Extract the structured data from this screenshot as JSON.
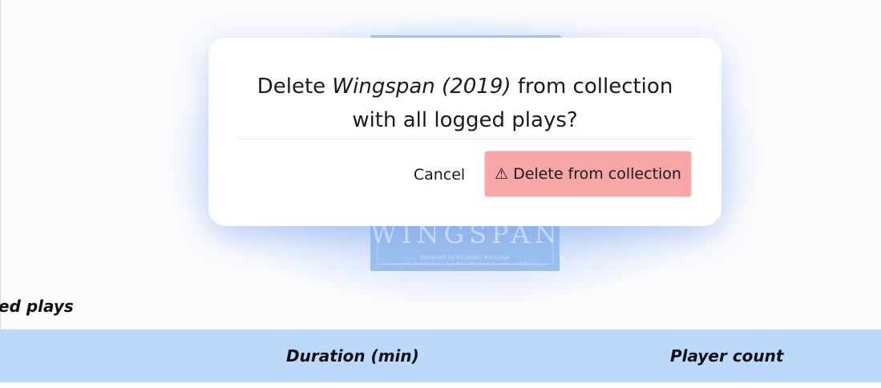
{
  "background": {
    "cover_title": "WINGSPAN",
    "cover_subtitle_1": "Designed by Elizabeth Hargrave",
    "cover_subtitle_2": "Illustrated by Natalia Rojas, Ana Maria Martinez Jaramillo, and Beth Sobel"
  },
  "section": {
    "title": "Logged plays",
    "title_visible": "ed plays"
  },
  "table": {
    "columns": [
      "Duration (min)",
      "Player count"
    ]
  },
  "dialog": {
    "message_prefix": "Delete ",
    "game_name": "Wingspan (2019)",
    "message_suffix": " from collection with all logged plays?",
    "cancel_label": "Cancel",
    "delete_icon": "warning-icon",
    "delete_icon_glyph": "⚠",
    "delete_label": "Delete from collection"
  },
  "colors": {
    "table_header": "#bcd9fb",
    "delete_button": "#f7a6a6",
    "glow": "#8cb4f8"
  }
}
